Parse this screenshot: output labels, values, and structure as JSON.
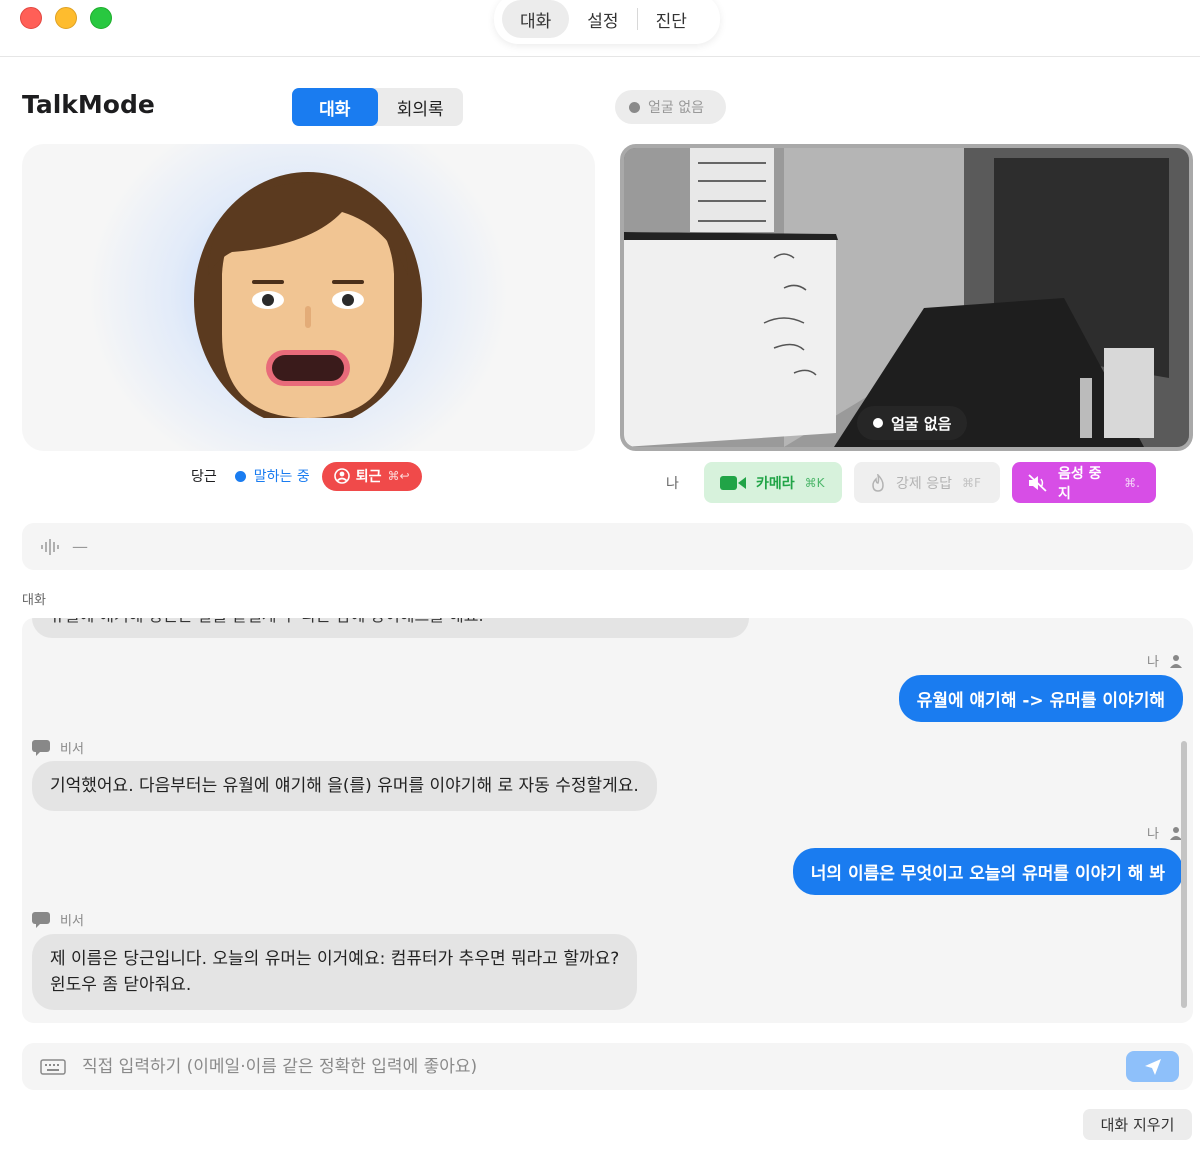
{
  "window": {
    "tabs": [
      "대화",
      "설정",
      "진단"
    ],
    "active_tab": "대화"
  },
  "header": {
    "title": "TalkMode",
    "segments": [
      "대화",
      "회의록"
    ],
    "active_segment": "대화",
    "face_status": "얼굴 없음"
  },
  "avatar": {
    "name": "당근",
    "state": "말하는 중",
    "leave_label": "퇴근",
    "leave_shortcut": "⌘↩"
  },
  "camera": {
    "badge": "얼굴 없음",
    "me_label": "나",
    "camera_label": "카메라",
    "camera_shortcut": "⌘K",
    "force_label": "강제 응답",
    "force_shortcut": "⌘F",
    "voice_label": "음성 중지",
    "voice_shortcut": "⌘."
  },
  "meter": {
    "icon": "waveform-icon",
    "value": "—"
  },
  "conversation": {
    "label": "대화",
    "partial_text": "유월에 얘기해 당근은 말을 끝낼게 수 라는 맘에 당이해드를 해요.",
    "messages": [
      {
        "sender": "나",
        "role": "user",
        "text": "유월에 얘기해 -> 유머를 이야기해"
      },
      {
        "sender": "비서",
        "role": "assistant",
        "text": "기억했어요. 다음부터는 유월에 얘기해 을(를) 유머를 이야기해 로 자동 수정할게요."
      },
      {
        "sender": "나",
        "role": "user",
        "text": "너의 이름은 무엇이고 오늘의 유머를 이야기 해 봐"
      },
      {
        "sender": "비서",
        "role": "assistant",
        "text_line1": "제 이름은 당근입니다. 오늘의 유머는 이거예요: 컴퓨터가 추우면 뭐라고 할까요?",
        "text_line2": "윈도우 좀 닫아줘요."
      }
    ]
  },
  "input": {
    "placeholder": "직접 입력하기 (이메일·이름 같은 정확한 입력에 좋아요)",
    "value": ""
  },
  "actions": {
    "clear_label": "대화 지우기"
  },
  "colors": {
    "accent": "#1a7cf0",
    "leave": "#f04a4a",
    "camera_green": "#21a447",
    "voice_purple": "#d74ee6"
  }
}
